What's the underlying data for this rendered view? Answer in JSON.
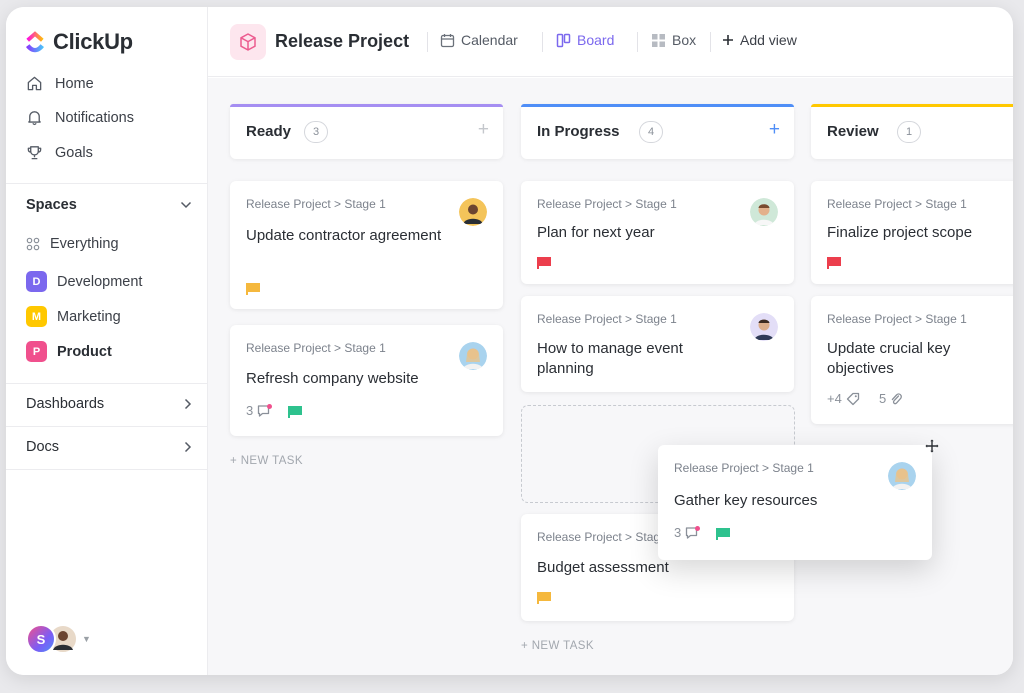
{
  "app": {
    "name": "ClickUp",
    "brand_colors": [
      "#7b68ee",
      "#f0508d",
      "#ffc800",
      "#4f8ef7"
    ]
  },
  "sidebar": {
    "nav": [
      {
        "label": "Home",
        "icon": "home-icon"
      },
      {
        "label": "Notifications",
        "icon": "bell-icon"
      },
      {
        "label": "Goals",
        "icon": "trophy-icon"
      }
    ],
    "spaces_label": "Spaces",
    "everything_label": "Everything",
    "spaces": [
      {
        "letter": "D",
        "label": "Development",
        "color": "#7b68ee"
      },
      {
        "letter": "M",
        "label": "Marketing",
        "color": "#ffc800"
      },
      {
        "letter": "P",
        "label": "Product",
        "color": "#f0508d"
      }
    ],
    "dashboards_label": "Dashboards",
    "docs_label": "Docs",
    "user_initial": "S"
  },
  "header": {
    "project_title": "Release Project",
    "views": [
      {
        "label": "Calendar",
        "icon": "calendar-icon"
      },
      {
        "label": "Board",
        "icon": "board-icon",
        "active": true
      },
      {
        "label": "Box",
        "icon": "box-icon"
      },
      {
        "label": "Add view",
        "icon": "plus-icon"
      }
    ]
  },
  "board": {
    "new_task_label": "+ NEW TASK",
    "columns": [
      {
        "title": "Ready",
        "count": "3",
        "color": "#a58ef2",
        "cards": [
          {
            "path": "Release Project > Stage 1",
            "title": "Update contractor agreement",
            "flag": "#f5b83d"
          },
          {
            "path": "Release Project > Stage 1",
            "title": "Refresh company website",
            "comments": "3",
            "flag": "#2ec28e"
          }
        ]
      },
      {
        "title": "In Progress",
        "count": "4",
        "color": "#4f8ef7",
        "cards": [
          {
            "path": "Release Project > Stage 1",
            "title": "Plan for next year",
            "flag": "#ec3e4d"
          },
          {
            "path": "Release Project > Stage 1",
            "title": "How to manage event planning"
          },
          {
            "path": "Release Project > Stage 1",
            "title": "Budget assessment",
            "flag": "#f5b83d"
          }
        ]
      },
      {
        "title": "Review",
        "count": "1",
        "color": "#ffc800",
        "cards": [
          {
            "path": "Release Project > Stage 1",
            "title": "Finalize project scope",
            "flag": "#ec3e4d"
          },
          {
            "path": "Release Project > Stage 1",
            "title": "Update crucial key objectives",
            "tags": "+4",
            "attachments": "5"
          }
        ]
      }
    ],
    "dragging_card": {
      "path": "Release Project > Stage 1",
      "title": "Gather key resources",
      "comments": "3",
      "flag": "#2ec28e"
    }
  }
}
